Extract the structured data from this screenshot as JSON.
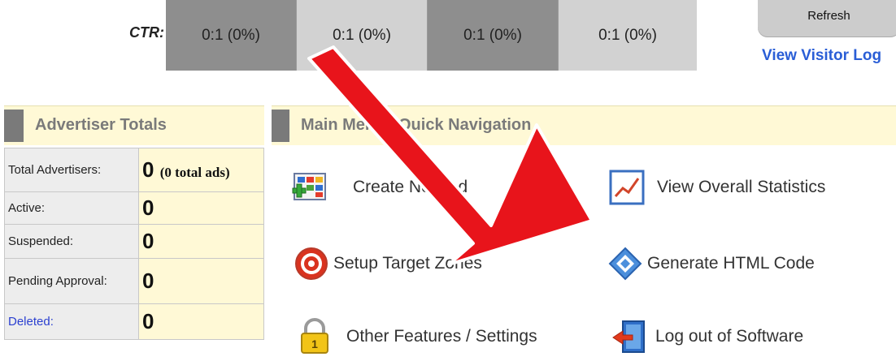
{
  "ctr": {
    "label": "CTR:",
    "cells": [
      "0:1 (0%)",
      "0:1 (0%)",
      "0:1 (0%)",
      "0:1 (0%)"
    ]
  },
  "top_right": {
    "refresh_label": "Refresh",
    "visitor_log_link": "View Visitor Log"
  },
  "advertiser_totals": {
    "title": "Advertiser Totals",
    "rows": [
      {
        "label": "Total Advertisers:",
        "value": "0",
        "note": "(0 total ads)"
      },
      {
        "label": "Active:",
        "value": "0"
      },
      {
        "label": "Suspended:",
        "value": "0"
      },
      {
        "label": "Pending Approval:",
        "value": "0"
      },
      {
        "label": "Deleted:",
        "value": "0"
      }
    ]
  },
  "main_menu": {
    "title": "Main Menu / Quick Navigation",
    "items": [
      {
        "label": "Create New Ad",
        "icon": "create-ad-icon"
      },
      {
        "label": "View Overall Statistics",
        "icon": "statistics-chart-icon"
      },
      {
        "label": "Setup Target Zones",
        "icon": "target-icon"
      },
      {
        "label": "Generate HTML Code",
        "icon": "html-code-icon"
      },
      {
        "label": "Other Features / Settings",
        "icon": "padlock-icon"
      },
      {
        "label": "Log out of Software",
        "icon": "logout-door-icon"
      }
    ]
  },
  "colors": {
    "header_bg": "#fff9d6",
    "link_blue": "#2a5ed6",
    "arrow_red": "#e8141b"
  }
}
